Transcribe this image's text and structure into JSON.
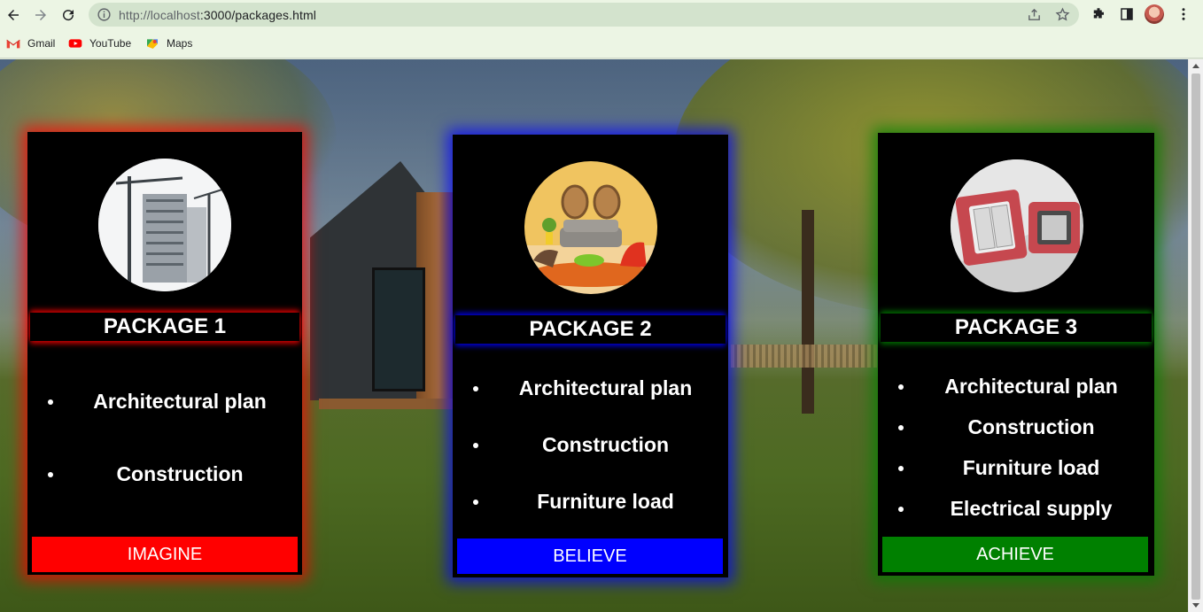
{
  "browser": {
    "url_host": "http://localhost",
    "url_rest": ":3000/packages.html",
    "bookmarks": [
      {
        "label": "Gmail"
      },
      {
        "label": "YouTube"
      },
      {
        "label": "Maps"
      }
    ]
  },
  "packages": [
    {
      "title": "PACKAGE 1",
      "theme": "red",
      "accent": "#ff0000",
      "image": "construction-building-photo",
      "features": [
        "Architectural plan",
        "Construction"
      ],
      "button": "IMAGINE"
    },
    {
      "title": "PACKAGE 2",
      "theme": "blue",
      "accent": "#0000ff",
      "image": "furnished-living-room-photo",
      "features": [
        "Architectural plan",
        "Construction",
        "Furniture load"
      ],
      "button": "BELIEVE"
    },
    {
      "title": "PACKAGE 3",
      "theme": "green",
      "accent": "#008000",
      "image": "electrical-switches-photo",
      "features": [
        "Architectural plan",
        "Construction",
        "Furniture load",
        "Electrical supply"
      ],
      "button": "ACHIEVE"
    }
  ]
}
